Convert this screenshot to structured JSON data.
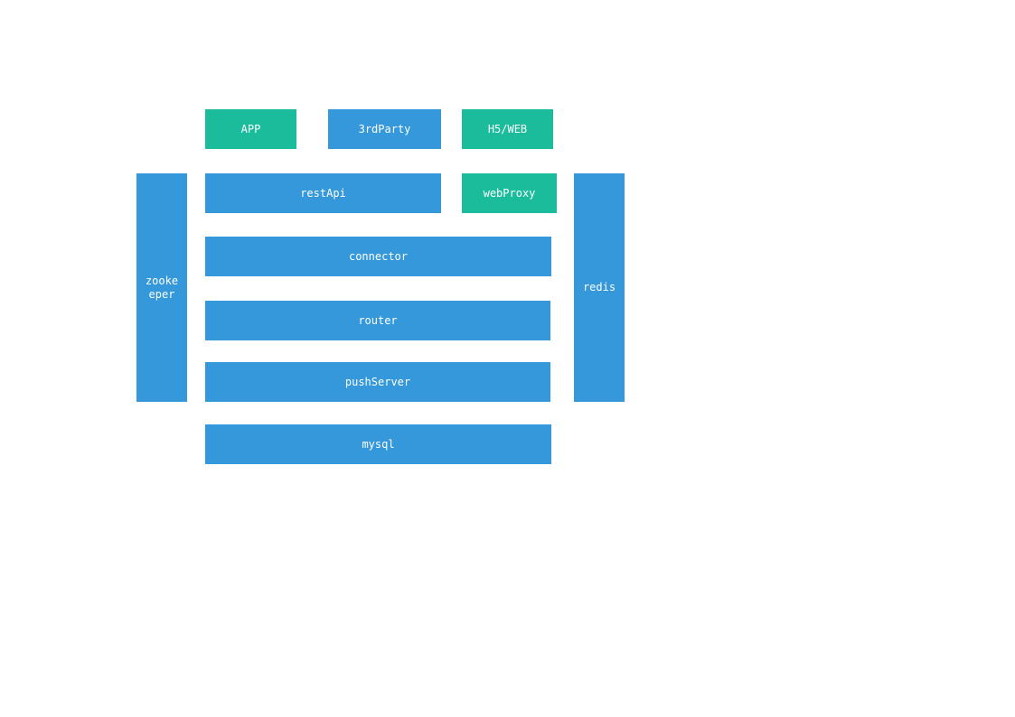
{
  "diagram": {
    "colors": {
      "blue": "#3498db",
      "green": "#1abc9c",
      "text": "#ffffff",
      "background": "#ffffff"
    },
    "clients": {
      "app": "APP",
      "third_party": "3rdParty",
      "h5_web": "H5/WEB"
    },
    "side": {
      "zookeeper": "zookeeper",
      "redis": "redis"
    },
    "layers": {
      "rest_api": "restApi",
      "web_proxy": "webProxy",
      "connector": "connector",
      "router": "router",
      "push_server": "pushServer",
      "mysql": "mysql"
    }
  }
}
